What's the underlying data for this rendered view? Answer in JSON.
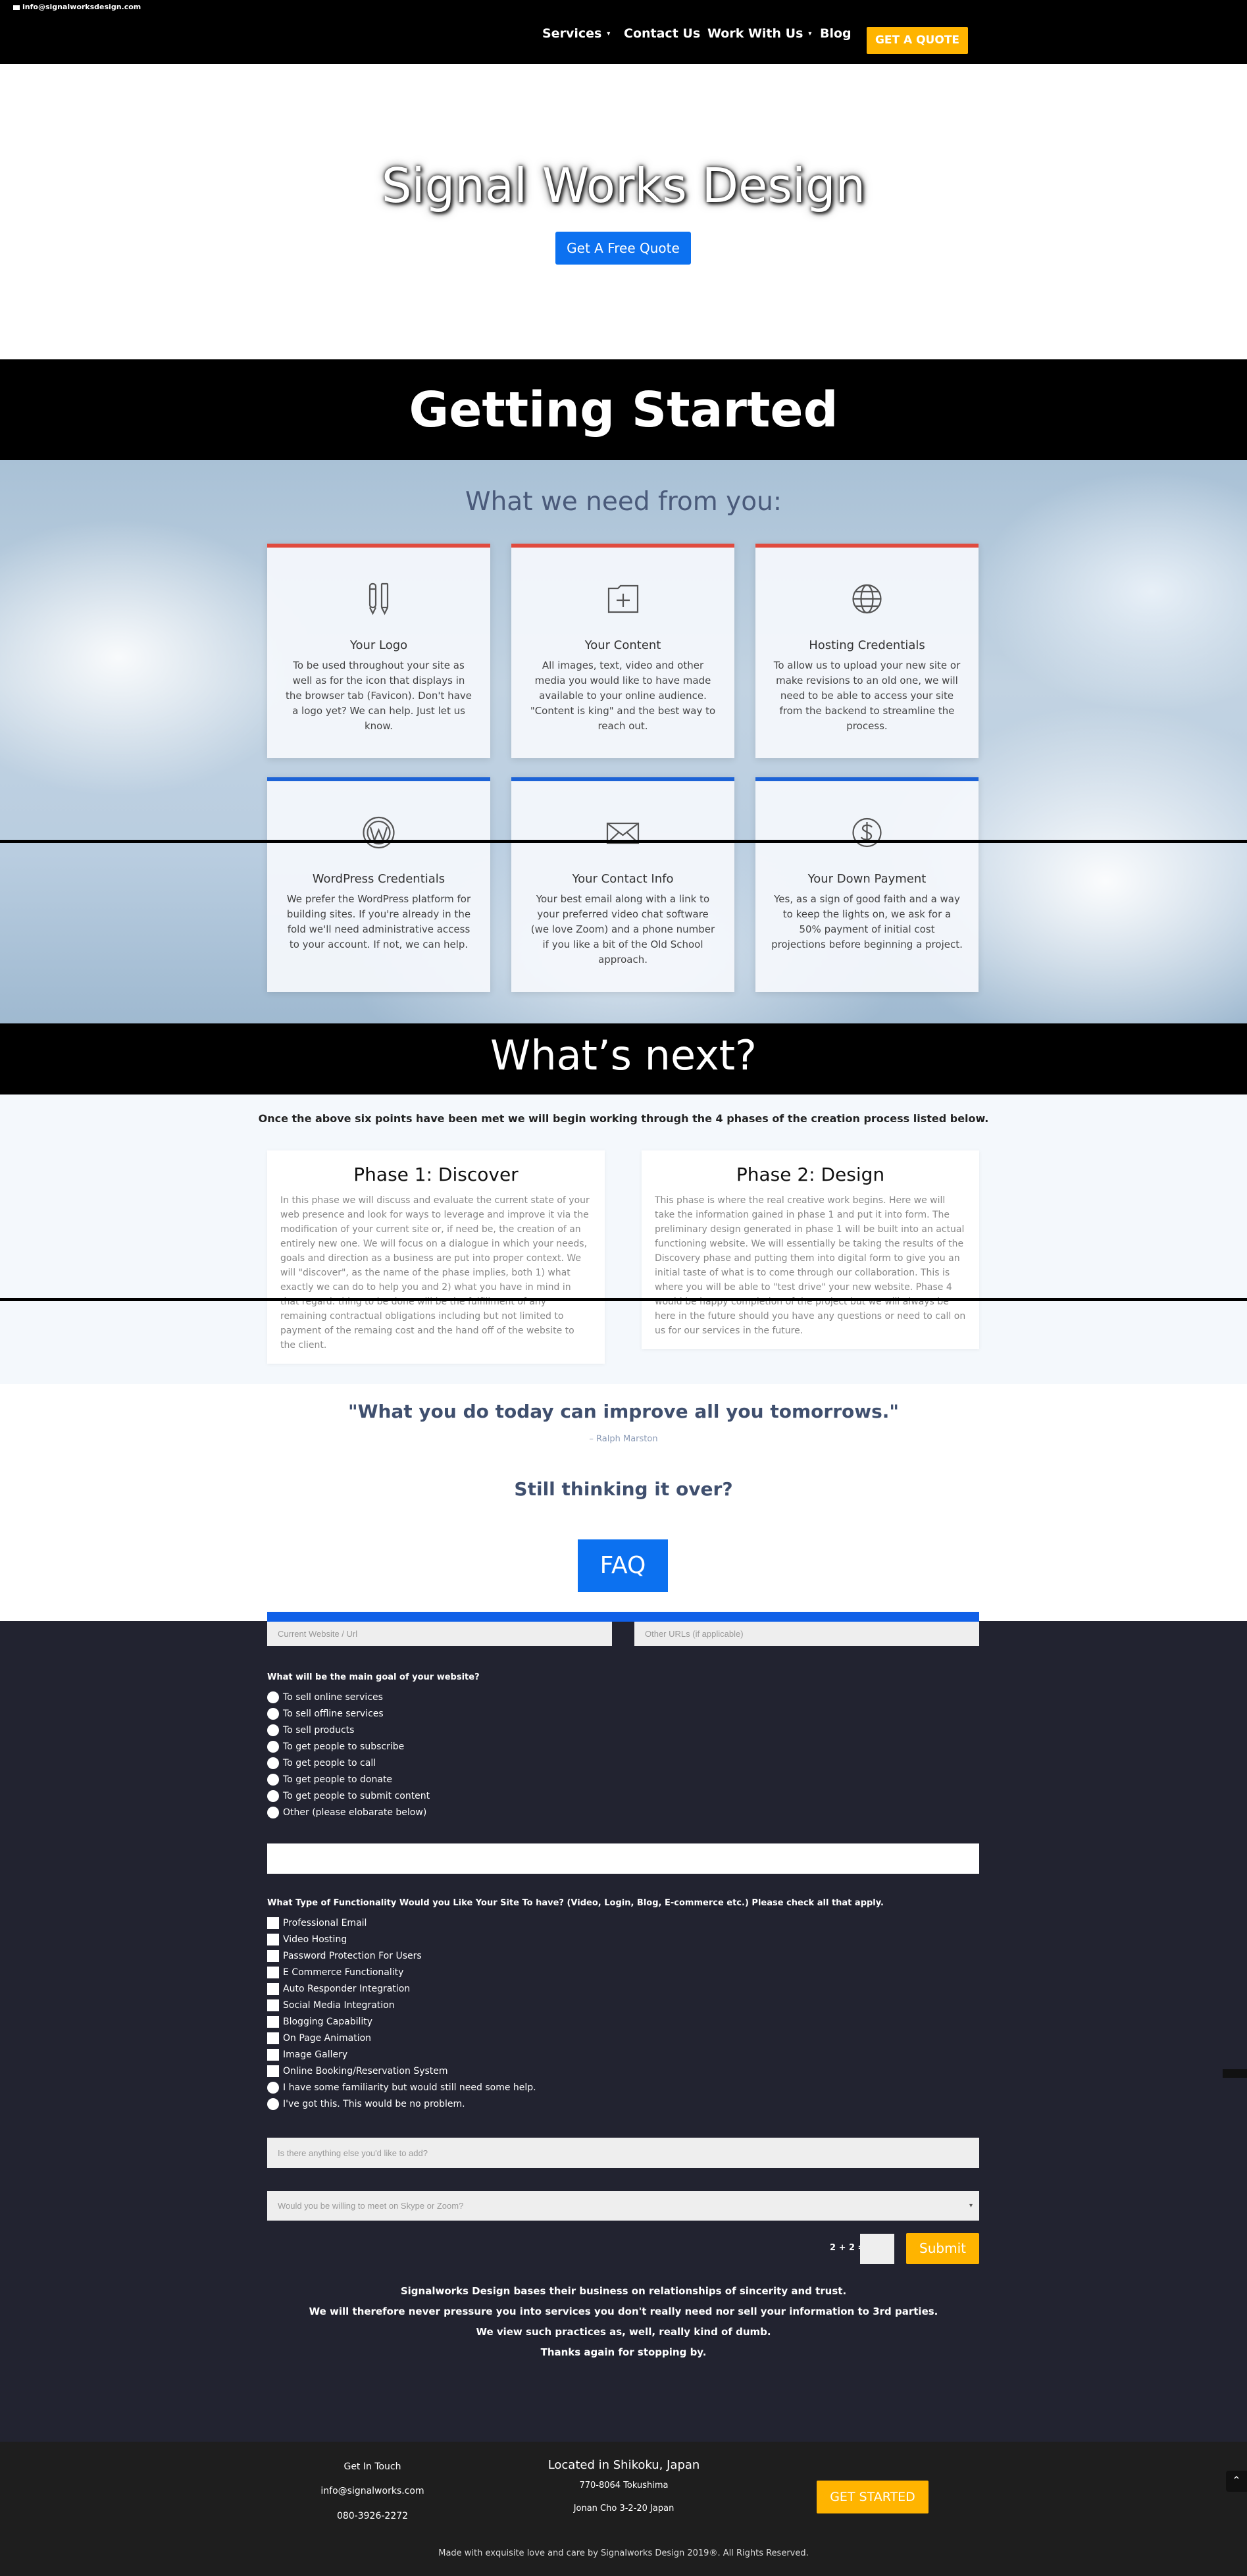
{
  "topbar": {
    "email": "info@signalworksdesign.com",
    "nav": [
      {
        "label": "Services",
        "has_dropdown": true
      },
      {
        "label": "Contact Us",
        "has_dropdown": false
      },
      {
        "label": "Work With Us",
        "has_dropdown": true
      },
      {
        "label": "Blog",
        "has_dropdown": false
      }
    ],
    "cta": "GET A QUOTE",
    "caret": "▾"
  },
  "hero": {
    "title": "Signal Works Design",
    "button": "Get A Free Quote"
  },
  "getting_started": {
    "title": "Getting Started",
    "subtitle": "What we need from you:",
    "cards": [
      {
        "icon": "pencil-icon",
        "title": "Your Logo",
        "text": "To be used throughout your site as well as for the icon that displays in the browser tab (Favicon). Don't have a logo yet? We can help. Just let us know."
      },
      {
        "icon": "folder-plus-icon",
        "title": "Your Content",
        "text": "All images, text, video and other media you would like to have made available to your online audience. \"Content is king\" and the best way to reach out."
      },
      {
        "icon": "globe-icon",
        "title": "Hosting Credentials",
        "text": "To allow us to upload your new site or make revisions to an old one, we will need to be able to access your site from the backend to streamline the process."
      },
      {
        "icon": "wordpress-icon",
        "title": "WordPress Credentials",
        "text": "We prefer the WordPress platform for building sites. If you're already in the fold we'll need administrative access to your account. If not, we can help."
      },
      {
        "icon": "envelope-icon",
        "title": "Your Contact Info",
        "text": "Your best email along with a link to your preferred video chat software (we love Zoom) and a phone number if you like a bit of the Old School approach."
      },
      {
        "icon": "dollar-icon",
        "title": "Your Down Payment",
        "text": "Yes, as a sign of good faith and a way to keep the lights on, we ask for a 50% payment of initial cost projections before beginning a project."
      }
    ]
  },
  "whats_next": {
    "title": "What’s next?",
    "intro": "Once the above six points have been met we will begin working through the 4 phases of the creation process listed below.",
    "phases": [
      {
        "title": "Phase 1: Discover",
        "text": "In this phase we will discuss and evaluate the current state of your web presence and look for ways to leverage and improve it via the modification of your current site or, if need be, the creation of an entirely new one. We will focus on a dialogue in which your needs, goals and direction as a business are put into proper context. We will \"discover\", as the name of the phase implies, both 1) what exactly we can do to help you and 2) what you have in mind in that regard. thing to be done will be the fulfillment of any remaining contractual obligations including but not limited to payment of the remaing cost and the hand off of the website to the client."
      },
      {
        "title": "Phase 2: Design",
        "text": "This phase is where the real creative work begins. Here we will take the information gained in phase 1 and put it into form. The preliminary design generated in phase 1 will be built into an actual functioning website. We will essentially be taking the results of the Discovery phase and putting them into digital form to give you an initial taste of what is to come through our collaboration. This is where you will be able to \"test drive\" your new website. Phase 4 would be happy completion of the project but we will always be here in the future should you have any questions or need to call on us for our services in the future."
      }
    ]
  },
  "quote": {
    "text": "\"What you do today can improve all you tomorrows.\"",
    "author": "– Ralph Marston"
  },
  "still_thinking": "Still thinking it over?",
  "faq_button": "FAQ",
  "form": {
    "current_website_placeholder": "Current Website / Url",
    "other_urls_placeholder": "Other URLs (if applicable)",
    "goal_question": "What will be the main goal of your website?",
    "goal_options": [
      "To sell online services",
      "To sell offline services",
      "To sell products",
      "To get people to subscribe",
      "To get people to call",
      "To get people to donate",
      "To get people to submit content",
      "Other (please elobarate below)"
    ],
    "functionality_question": "What Type of Functionality Would you Like Your Site To have? (Video, Login, Blog, E-commerce etc.) Please check all that apply.",
    "functionality_options": [
      "Professional Email",
      "Video Hosting",
      "Password Protection For Users",
      "E Commerce Functionality",
      "Auto Responder Integration",
      "Social Media Integration",
      "Blogging Capability",
      "On Page Animation",
      "Image Gallery",
      "Online Booking/Reservation System"
    ],
    "familiarity_options": [
      "I have some familiarity but would still need some help.",
      "I've got this. This would be no problem."
    ],
    "anything_else_placeholder": "Is there anything else you'd like to add?",
    "meet_placeholder": "Would you be willing to meet on Skype or Zoom?",
    "captcha_label": "2 + 2 =",
    "submit": "Submit"
  },
  "closing": [
    "Signalworks Design bases their business on relationships of sincerity and trust.",
    "We will therefore never pressure you into services you don't really need nor sell your information to 3rd parties.",
    "We view such practices as, well, really kind of dumb.",
    "Thanks again for stopping by."
  ],
  "footer": {
    "get_in_touch": "Get In Touch",
    "email": "info@signalworks.com",
    "phone": "080-3926-2272",
    "location_title": "Located in Shikoku, Japan",
    "postal": "770-8064 Tokushima",
    "address": "Jonan Cho 3-2-20 Japan",
    "cta": "GET STARTED",
    "copyright": "Made with exquisite love and care by Signalworks Design 2019®. All Rights Reserved.",
    "scroll_top_glyph": "⌃"
  },
  "colors": {
    "accent_yellow": "#ffb400",
    "accent_blue": "#0c71f0",
    "card_red": "#e04a3e",
    "card_blue": "#1d63d6",
    "form_bg": "#222330"
  }
}
